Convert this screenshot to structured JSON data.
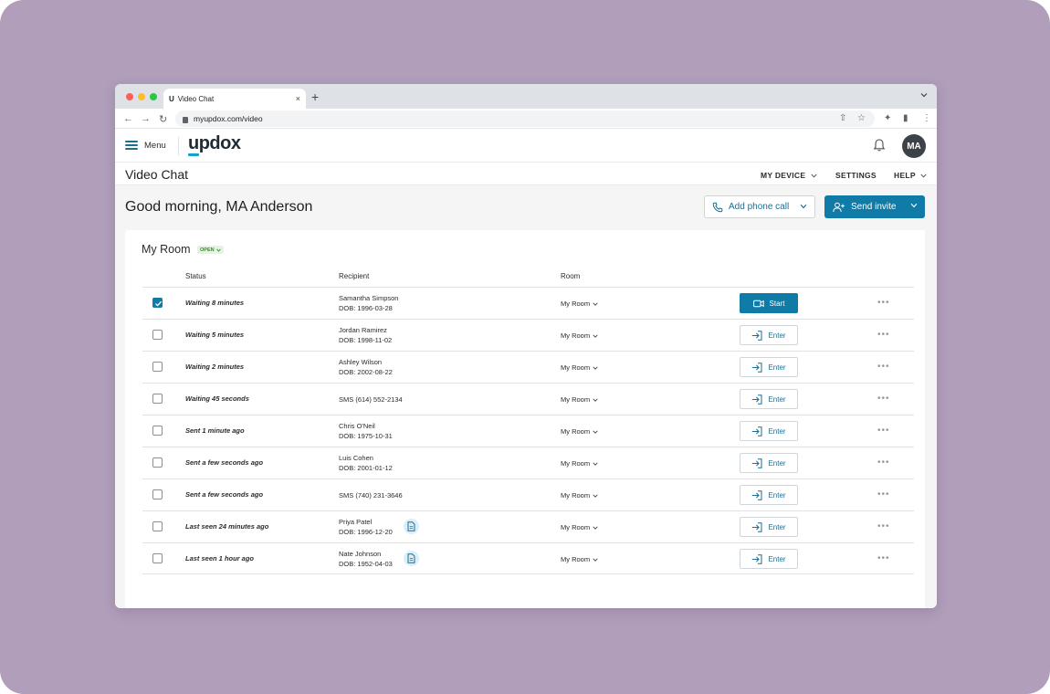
{
  "browser": {
    "tab_title": "Video Chat",
    "tab_favicon": "U",
    "tab_close": "×",
    "new_tab": "+",
    "url": "myupdox.com/video"
  },
  "header": {
    "menu_label": "Menu",
    "logo": "updox",
    "avatar_initials": "MA"
  },
  "subheader": {
    "title": "Video Chat",
    "nav": [
      "MY DEVICE",
      "SETTINGS",
      "HELP"
    ]
  },
  "main": {
    "greeting": "Good morning, MA Anderson",
    "add_phone_label": "Add phone call",
    "send_invite_label": "Send invite"
  },
  "room": {
    "title": "My Room",
    "badge": "OPEN",
    "columns": [
      "Status",
      "Recipient",
      "Room"
    ],
    "rows": [
      {
        "checked": true,
        "status": "Waiting 8 minutes",
        "name": "Samantha Simpson",
        "dob": "DOB: 1996-03-28",
        "doc": false,
        "room": "My Room",
        "action": "Start"
      },
      {
        "checked": false,
        "status": "Waiting 5 minutes",
        "name": "Jordan Ramirez",
        "dob": "DOB: 1998-11-02",
        "doc": false,
        "room": "My Room",
        "action": "Enter"
      },
      {
        "checked": false,
        "status": "Waiting 2 minutes",
        "name": "Ashley Wilson",
        "dob": "DOB: 2002-08-22",
        "doc": false,
        "room": "My Room",
        "action": "Enter"
      },
      {
        "checked": false,
        "status": "Waiting 45 seconds",
        "name": "SMS (614) 552-2134",
        "dob": "",
        "doc": false,
        "room": "My Room",
        "action": "Enter"
      },
      {
        "checked": false,
        "status": "Sent 1 minute ago",
        "name": "Chris O'Neil",
        "dob": "DOB: 1975-10-31",
        "doc": false,
        "room": "My Room",
        "action": "Enter"
      },
      {
        "checked": false,
        "status": "Sent a few seconds ago",
        "name": "Luis Cohen",
        "dob": "DOB: 2001-01-12",
        "doc": false,
        "room": "My Room",
        "action": "Enter"
      },
      {
        "checked": false,
        "status": "Sent a few seconds ago",
        "name": "SMS (740) 231-3646",
        "dob": "",
        "doc": false,
        "room": "My Room",
        "action": "Enter"
      },
      {
        "checked": false,
        "status": "Last seen 24 minutes ago",
        "name": "Priya Patel",
        "dob": "DOB: 1996-12-20",
        "doc": true,
        "room": "My Room",
        "action": "Enter"
      },
      {
        "checked": false,
        "status": "Last seen 1 hour ago",
        "name": "Nate Johnson",
        "dob": "DOB: 1952-04-03",
        "doc": true,
        "room": "My Room",
        "action": "Enter"
      }
    ]
  },
  "colors": {
    "backdrop": "#b09ebb",
    "primary": "#0f7ba6",
    "logo_accent": "#13a5c9",
    "badge_bg": "#e3f5e0",
    "badge_text": "#3a8a2a"
  },
  "icons": {
    "menu": "hamburger-icon",
    "notifications": "bell-icon",
    "phone": "phone-icon",
    "invite": "add-user-icon",
    "start": "video-camera-icon",
    "enter": "sign-in-icon",
    "more": "more-horizontal-icon",
    "doc": "document-icon"
  }
}
